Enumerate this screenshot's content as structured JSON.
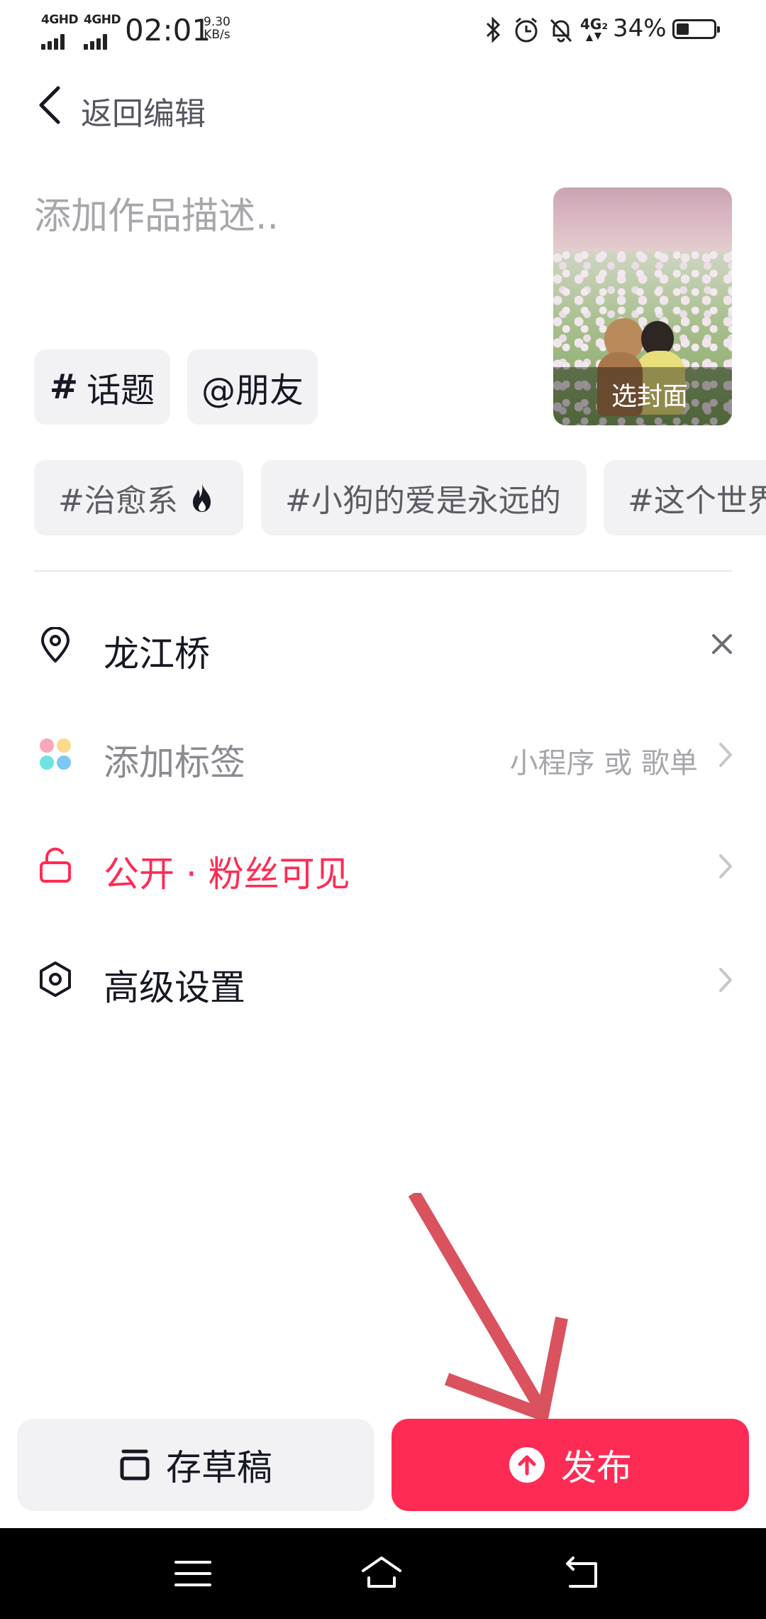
{
  "status_bar": {
    "network_1": "4GHD",
    "network_2": "4GHD",
    "time": "02:01",
    "speed_value": "9.30",
    "speed_unit": "KB/s",
    "network_3": "4G₂",
    "battery": "34%",
    "battery_level": 0.34
  },
  "header": {
    "back_label": "返回编辑"
  },
  "description": {
    "placeholder": "添加作品描述..",
    "value": ""
  },
  "cover": {
    "label": "选封面"
  },
  "chips": {
    "topic": "话题",
    "topic_symbol": "#",
    "friend": "@朋友"
  },
  "suggested_tags": [
    "#治愈系",
    "#小狗的爱是永远的",
    "#这个世界"
  ],
  "rows": {
    "location": "龙江桥",
    "add_tag": "添加标签",
    "add_tag_hint": "小程序 或 歌单",
    "visibility": "公开 · 粉丝可见",
    "advanced": "高级设置"
  },
  "buttons": {
    "draft": "存草稿",
    "publish": "发布"
  },
  "colors": {
    "accent": "#fe2c55",
    "annotation_arrow": "#d9525e"
  }
}
